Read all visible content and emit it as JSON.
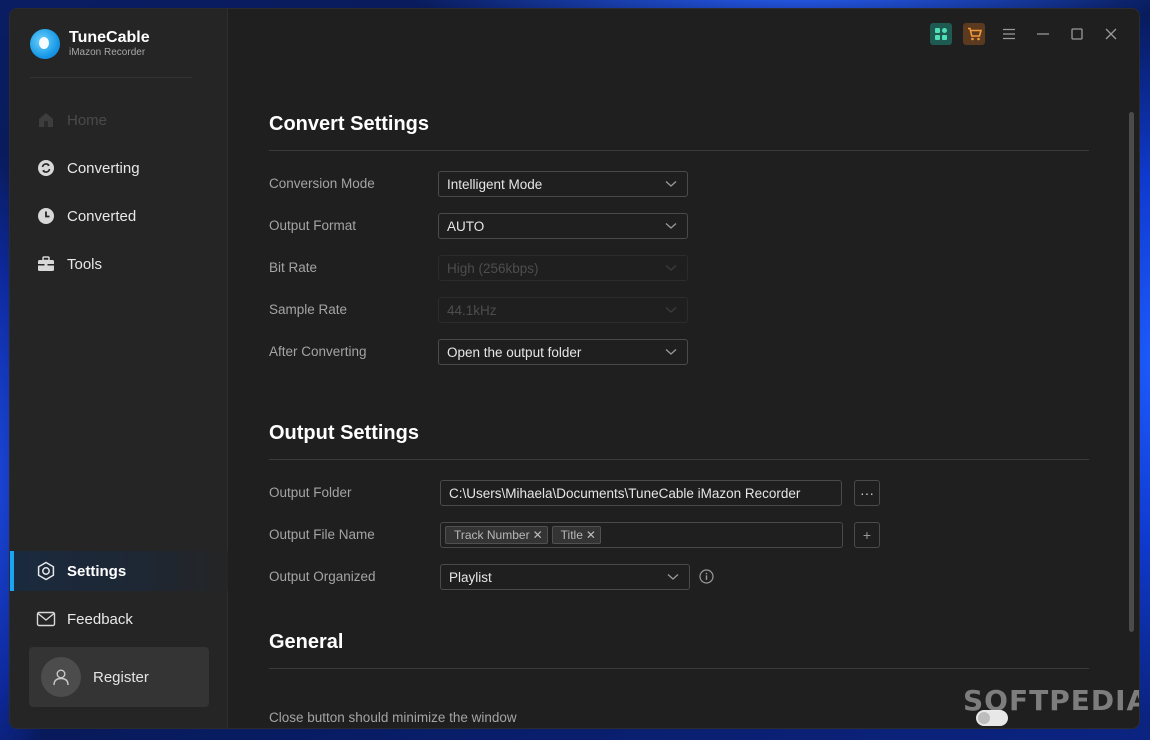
{
  "brand": {
    "name": "TuneCable",
    "subtitle": "iMazon Recorder"
  },
  "sidebar": {
    "items": [
      {
        "label": "Home",
        "icon": "home-icon",
        "state": "disabled"
      },
      {
        "label": "Converting",
        "icon": "sync-icon",
        "state": "normal"
      },
      {
        "label": "Converted",
        "icon": "clock-icon",
        "state": "normal"
      },
      {
        "label": "Tools",
        "icon": "toolbox-icon",
        "state": "normal"
      },
      {
        "label": "Settings",
        "icon": "settings-icon",
        "state": "active"
      },
      {
        "label": "Feedback",
        "icon": "mail-icon",
        "state": "normal"
      }
    ],
    "register_label": "Register"
  },
  "convert": {
    "title": "Convert Settings",
    "mode_label": "Conversion Mode",
    "mode_value": "Intelligent Mode",
    "format_label": "Output Format",
    "format_value": "AUTO",
    "bitrate_label": "Bit Rate",
    "bitrate_value": "High (256kbps)",
    "samplerate_label": "Sample Rate",
    "samplerate_value": "44.1kHz",
    "after_label": "After Converting",
    "after_value": "Open the output folder"
  },
  "output": {
    "title": "Output Settings",
    "folder_label": "Output Folder",
    "folder_value": "C:\\Users\\Mihaela\\Documents\\TuneCable iMazon Recorder",
    "folder_browse": "···",
    "filename_label": "Output File Name",
    "filename_tags": [
      "Track Number",
      "Title"
    ],
    "filename_add": "+",
    "organized_label": "Output Organized",
    "organized_value": "Playlist"
  },
  "general": {
    "title": "General",
    "close_label": "Close button should minimize the window",
    "close_toggle": "off"
  },
  "watermark": {
    "text": "SOFTPEDIA",
    "mark": "®"
  },
  "colors": {
    "accent": "#1aa5f2",
    "background": "#1f1f1f",
    "sidebar": "#252525",
    "apps_button": "#1f5a52",
    "cart_button": "#5b3a1f"
  }
}
